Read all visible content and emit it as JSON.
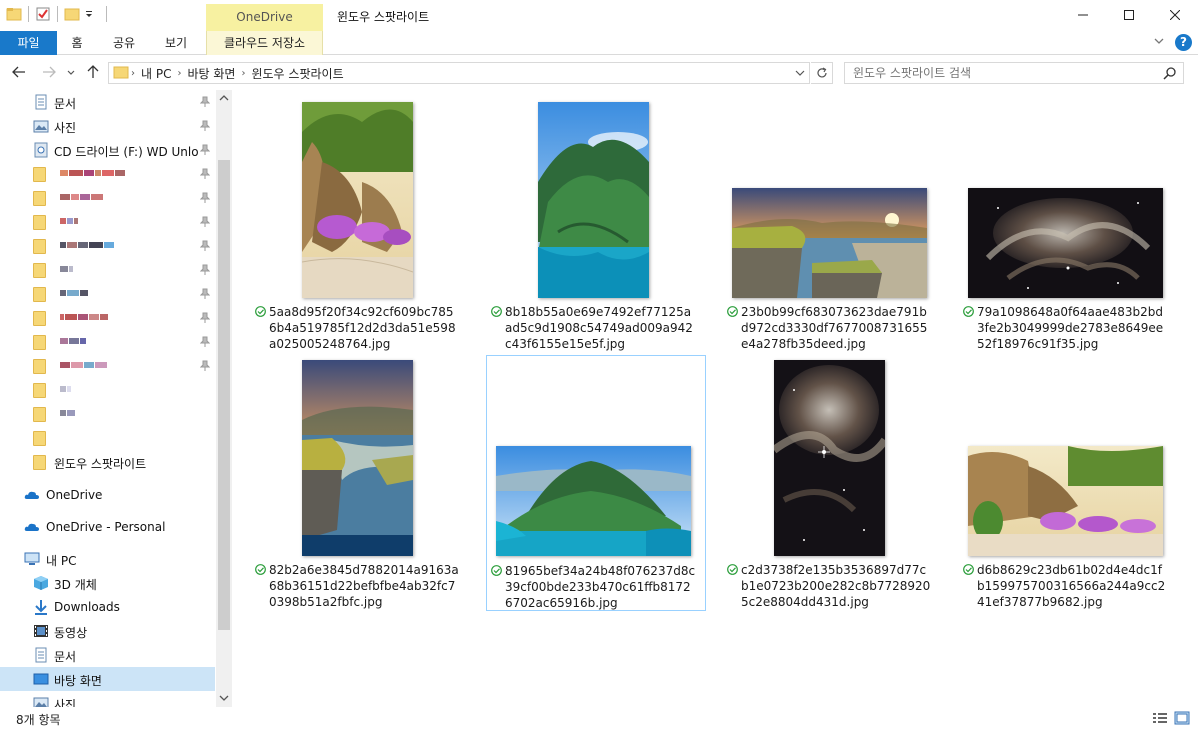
{
  "window": {
    "title": "윈도우 스팟라이트",
    "context_tab_group": "OneDrive"
  },
  "ribbon": {
    "tabs": [
      "파일",
      "홈",
      "공유",
      "보기",
      "클라우드 저장소"
    ]
  },
  "address": {
    "crumbs": [
      "내 PC",
      "바탕 화면",
      "윈도우 스팟라이트"
    ]
  },
  "search": {
    "placeholder": "윈도우 스팟라이트 검색"
  },
  "nav": {
    "quick_access": [
      {
        "label": "문서",
        "icon": "document-icon",
        "pinned": true
      },
      {
        "label": "사진",
        "icon": "pictures-icon",
        "pinned": true
      },
      {
        "label": "CD 드라이브 (F:) WD Unlocker",
        "icon": "cd-drive-icon",
        "pinned": true
      },
      {
        "label": "",
        "icon": "folder-icon",
        "pinned": true,
        "redacted": true
      },
      {
        "label": "",
        "icon": "folder-icon",
        "pinned": true,
        "redacted": true
      },
      {
        "label": "",
        "icon": "folder-icon",
        "pinned": true,
        "redacted": true
      },
      {
        "label": "",
        "icon": "folder-icon",
        "pinned": true,
        "redacted": true
      },
      {
        "label": "",
        "icon": "folder-icon",
        "pinned": true,
        "redacted": true
      },
      {
        "label": "",
        "icon": "folder-icon",
        "pinned": true,
        "redacted": true
      },
      {
        "label": "",
        "icon": "folder-icon",
        "pinned": true,
        "redacted": true
      },
      {
        "label": "",
        "icon": "folder-icon",
        "pinned": true,
        "redacted": true
      },
      {
        "label": "",
        "icon": "folder-icon",
        "pinned": true,
        "redacted": true
      },
      {
        "label": "",
        "icon": "folder-icon",
        "pinned": false,
        "redacted": true
      },
      {
        "label": "",
        "icon": "folder-icon",
        "pinned": false,
        "redacted": true
      },
      {
        "label": "",
        "icon": "folder-icon",
        "pinned": false,
        "redacted": false
      },
      {
        "label": "윈도우 스팟라이트",
        "icon": "folder-icon",
        "pinned": false
      }
    ],
    "roots": [
      {
        "label": "OneDrive",
        "icon": "onedrive-icon"
      },
      {
        "label": "OneDrive - Personal",
        "icon": "onedrive-icon"
      },
      {
        "label": "내 PC",
        "icon": "this-pc-icon"
      }
    ],
    "this_pc": [
      {
        "label": "3D 개체",
        "icon": "3d-objects-icon"
      },
      {
        "label": "Downloads",
        "icon": "downloads-icon"
      },
      {
        "label": "동영상",
        "icon": "videos-icon"
      },
      {
        "label": "문서",
        "icon": "document-icon"
      },
      {
        "label": "바탕 화면",
        "icon": "desktop-icon",
        "selected": true
      },
      {
        "label": "사진",
        "icon": "pictures-icon"
      }
    ]
  },
  "files": [
    {
      "name": "5aa8d95f20f34c92cf609bc7856b4a519785f12d2d3da51e598a025005248764.jpg",
      "orientation": "portrait",
      "scene": "garden-palms"
    },
    {
      "name": "8b18b55a0e69e7492ef77125aad5c9d1908c54749ad009a942c43f6155e15e5f.jpg",
      "orientation": "portrait",
      "scene": "mountain-lake"
    },
    {
      "name": "23b0b99cf683073623dae791bd972cd3330df7677008731655e4a278fb35deed.jpg",
      "orientation": "landscape",
      "scene": "cliff-sunset"
    },
    {
      "name": "79a1098648a0f64aae483b2bd3fe2b3049999de2783e8649ee52f18976c91f35.jpg",
      "orientation": "landscape",
      "scene": "nebula"
    },
    {
      "name": "82b2a6e3845d7882014a9163a68b36151d22befbfbe4ab32fc70398b51a2fbfc.jpg",
      "orientation": "portrait",
      "scene": "cliff-sunset"
    },
    {
      "name": "81965bef34a24b48f076237d8c39cf00bde233b470c61ffb81726702ac65916b.jpg",
      "orientation": "landscape",
      "scene": "mountain-lake",
      "selected": true
    },
    {
      "name": "c2d3738f2e135b3536897d77cb1e0723b200e282c8b77289205c2e8804dd431d.jpg",
      "orientation": "portrait",
      "scene": "nebula"
    },
    {
      "name": "d6b8629c23db61b02d4e4dc1fb159975700316566a244a9cc241ef37877b9682.jpg",
      "orientation": "landscape",
      "scene": "garden-palms"
    }
  ],
  "status": {
    "item_count": "8개 항목"
  }
}
